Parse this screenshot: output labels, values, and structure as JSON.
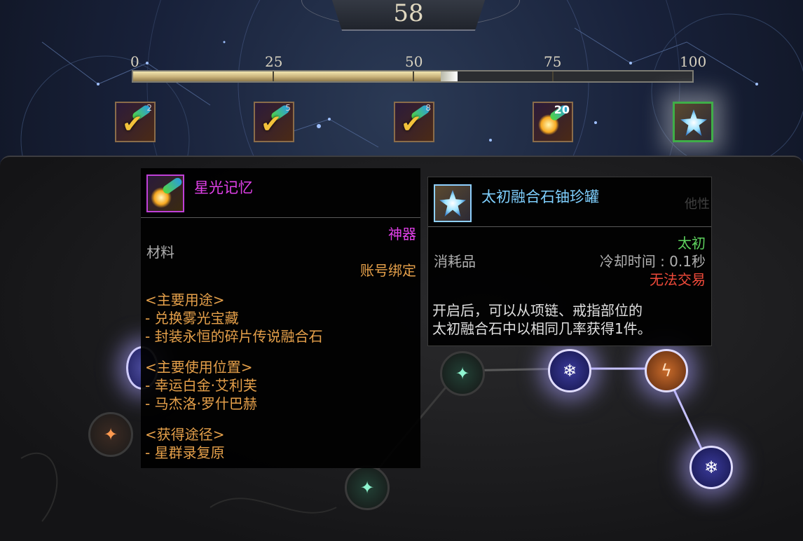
{
  "level": "58",
  "progress": {
    "ticks": [
      "0",
      "25",
      "50",
      "75",
      "100"
    ],
    "value": 58
  },
  "rewards": [
    {
      "count": "2",
      "claimed": true
    },
    {
      "count": "5",
      "claimed": true
    },
    {
      "count": "8",
      "claimed": true
    },
    {
      "count": "20",
      "claimed": false
    },
    {
      "count": "",
      "claimed": false,
      "highlighted": true
    }
  ],
  "tooltip_left": {
    "title": "星光记忆",
    "rarity": "神器",
    "type": "材料",
    "binding": "账号绑定",
    "usage_header": "<主要用途>",
    "usage_1": "- 兑换雾光宝藏",
    "usage_2": "- 封装永恒的碎片传说融合石",
    "location_header": "<主要使用位置>",
    "location_1": "- 幸运白金·艾利芙",
    "location_2": "- 马杰洛·罗什巴赫",
    "obtain_header": "<获得途径>",
    "obtain_1": "- 星群录复原"
  },
  "tooltip_right": {
    "title": "太初融合石铀珍罐",
    "rarity": "太初",
    "type": "消耗品",
    "cooldown": "冷却时间 : 0.1秒",
    "trade": "无法交易",
    "desc_1": "开启后，可以从项链、戒指部位的",
    "desc_2": "太初融合石中以相同几率获得1件。",
    "partial_text": "他性"
  },
  "colors": {
    "legendary": "#e040e8",
    "primordial": "#5ed35e",
    "account_bound": "#e5a04a",
    "untradeable": "#f04a3a",
    "title_right": "#7fd0ff"
  }
}
